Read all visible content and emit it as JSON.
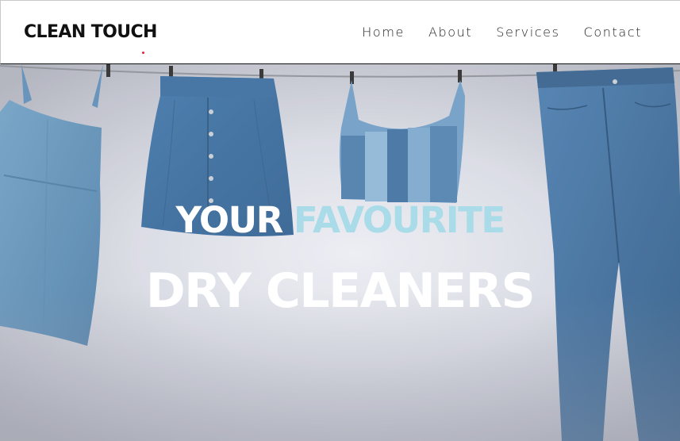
{
  "brand": {
    "name": "CLEAN TOUCH",
    "accent_color": "#e0263b"
  },
  "nav": {
    "items": [
      "Home",
      "About",
      "Services",
      "Contact"
    ]
  },
  "hero": {
    "line1_word1": "YOUR",
    "line1_word2": "FAVOURITE",
    "line2": "DRY CLEANERS",
    "highlight_color": "#a9dbe8",
    "image": "denim clothes hanging on a clothesline"
  }
}
